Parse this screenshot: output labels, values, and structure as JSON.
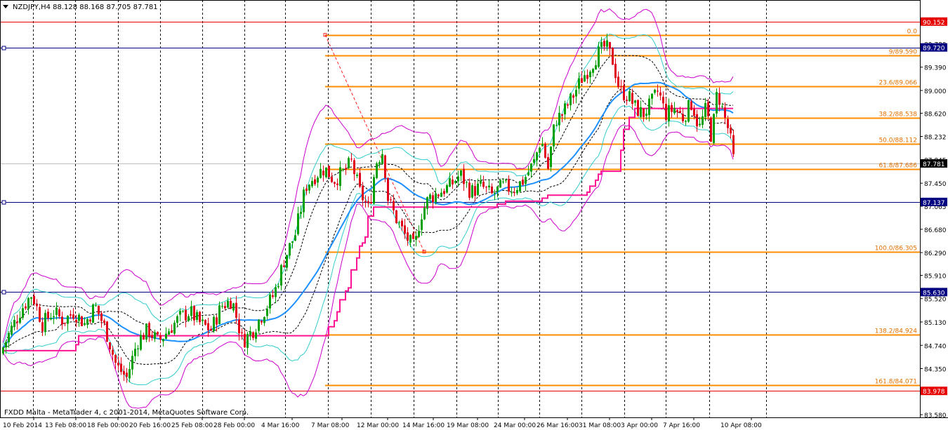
{
  "header": {
    "symbol_info": "NZDJPY,H4  88.128 88.168 87.705 87.781"
  },
  "footer": {
    "copyright": "FXDD Malta - MetaTrader 4, c 2001-2014, MetaQuotes Software Corp."
  },
  "colors": {
    "background": "#ffffff",
    "grid": "#000000",
    "bull_candle": "#00a000",
    "bear_candle": "#e0001a",
    "fibo": "#ff8c00",
    "fibo_text": "#e07000",
    "bollinger_outer": "#cc00cc",
    "bollinger_inner": "#33cccc",
    "ma_blue": "#1e90ff",
    "envelope_dashed": "#000000",
    "step_line": "#ff1493",
    "red_level": "#e60000",
    "blue_level": "#000080"
  },
  "chart_data": {
    "type": "candlestick",
    "symbol": "NZDJPY",
    "timeframe": "H4",
    "ohlc_current": {
      "open": 88.128,
      "high": 88.168,
      "low": 87.705,
      "close": 87.781
    },
    "ylim": [
      83.5,
      90.35
    ],
    "grid": true,
    "y_ticks": [
      "89.780",
      "89.390",
      "89.000",
      "88.620",
      "88.232",
      "87.845",
      "87.450",
      "87.065",
      "86.680",
      "86.290",
      "85.910",
      "85.520",
      "85.130",
      "84.740",
      "84.350",
      "83.580"
    ],
    "x_ticks": [
      "10 Feb 2014",
      "13 Feb 08:00",
      "18 Feb 00:00",
      "20 Feb 16:00",
      "25 Feb 08:00",
      "28 Feb 00:00",
      "4 Mar 16:00",
      "7 Mar 08:00",
      "12 Mar 00:00",
      "14 Mar 16:00",
      "19 Mar 08:00",
      "24 Mar 00:00",
      "26 Mar 16:00",
      "31 Mar 08:00",
      "3 Apr 00:00",
      "7 Apr 16:00",
      "10 Apr 08:00"
    ],
    "horizontal_levels": [
      {
        "label": "90.152",
        "value": 90.152,
        "color": "#e60000"
      },
      {
        "label": "89.720",
        "value": 89.72,
        "color": "#000080"
      },
      {
        "label": "87.137",
        "value": 87.137,
        "color": "#000080"
      },
      {
        "label": "85.630",
        "value": 85.63,
        "color": "#000080"
      },
      {
        "label": "83.978",
        "value": 83.978,
        "color": "#e60000"
      }
    ],
    "current_price": {
      "label": "87.781",
      "value": 87.781
    },
    "fibonacci": [
      {
        "label": "0.0",
        "value": 89.93
      },
      {
        "label": "9/89.590",
        "value": 89.59
      },
      {
        "label": "23.6/89.066",
        "value": 89.066
      },
      {
        "label": "38.2/88.538",
        "value": 88.538
      },
      {
        "label": "50.0/88.112",
        "value": 88.112
      },
      {
        "label": "61.8/87.686",
        "value": 87.686
      },
      {
        "label": "100.0/86.305",
        "value": 86.305
      },
      {
        "label": "138.2/84.924",
        "value": 84.924
      },
      {
        "label": "161.8/84.071",
        "value": 84.071
      }
    ],
    "price_path_keypoints": [
      [
        0,
        84.6
      ],
      [
        15,
        85.0
      ],
      [
        30,
        85.35
      ],
      [
        45,
        85.6
      ],
      [
        60,
        85.1
      ],
      [
        75,
        85.3
      ],
      [
        90,
        85.15
      ],
      [
        105,
        85.3
      ],
      [
        120,
        85.1
      ],
      [
        135,
        85.4
      ],
      [
        150,
        85.0
      ],
      [
        165,
        84.4
      ],
      [
        180,
        84.2
      ],
      [
        195,
        84.8
      ],
      [
        210,
        85.0
      ],
      [
        225,
        84.8
      ],
      [
        240,
        85.0
      ],
      [
        255,
        85.2
      ],
      [
        270,
        85.3
      ],
      [
        285,
        85.1
      ],
      [
        300,
        85.0
      ],
      [
        315,
        85.4
      ],
      [
        330,
        85.5
      ],
      [
        345,
        84.8
      ],
      [
        360,
        85.0
      ],
      [
        375,
        85.3
      ],
      [
        390,
        85.6
      ],
      [
        405,
        86.2
      ],
      [
        420,
        86.6
      ],
      [
        435,
        87.4
      ],
      [
        450,
        87.6
      ],
      [
        462,
        87.7
      ],
      [
        475,
        87.5
      ],
      [
        490,
        87.65
      ],
      [
        500,
        87.8
      ],
      [
        512,
        87.3
      ],
      [
        525,
        87.0
      ],
      [
        535,
        87.8
      ],
      [
        545,
        88.0
      ],
      [
        552,
        87.2
      ],
      [
        562,
        86.9
      ],
      [
        575,
        86.6
      ],
      [
        590,
        86.35
      ],
      [
        598,
        86.9
      ],
      [
        610,
        87.2
      ],
      [
        625,
        87.3
      ],
      [
        640,
        87.4
      ],
      [
        655,
        87.6
      ],
      [
        670,
        87.3
      ],
      [
        685,
        87.4
      ],
      [
        700,
        87.25
      ],
      [
        715,
        87.4
      ],
      [
        730,
        87.35
      ],
      [
        745,
        87.5
      ],
      [
        760,
        87.8
      ],
      [
        770,
        88.2
      ],
      [
        780,
        87.7
      ],
      [
        790,
        88.5
      ],
      [
        800,
        88.6
      ],
      [
        815,
        88.9
      ],
      [
        828,
        89.2
      ],
      [
        840,
        89.4
      ],
      [
        850,
        89.6
      ],
      [
        862,
        89.75
      ],
      [
        872,
        89.5
      ],
      [
        882,
        89.0
      ],
      [
        895,
        88.9
      ],
      [
        905,
        88.7
      ],
      [
        915,
        88.6
      ],
      [
        925,
        88.75
      ],
      [
        937,
        89.0
      ],
      [
        947,
        88.6
      ],
      [
        960,
        88.7
      ],
      [
        972,
        88.55
      ],
      [
        985,
        88.8
      ],
      [
        995,
        88.35
      ],
      [
        1005,
        88.7
      ],
      [
        1013,
        88.2
      ],
      [
        1021,
        89.0
      ],
      [
        1030,
        88.6
      ],
      [
        1038,
        88.3
      ],
      [
        1045,
        87.78
      ]
    ]
  }
}
